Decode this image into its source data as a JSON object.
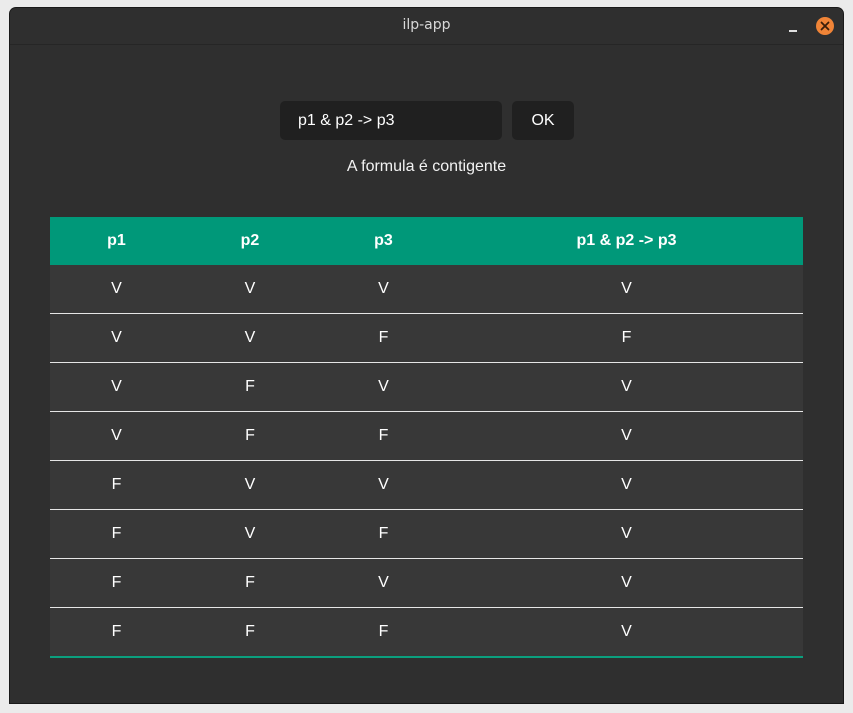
{
  "window": {
    "title": "ilp-app"
  },
  "form": {
    "formula_value": "p1 & p2 -> p3",
    "ok_label": "OK"
  },
  "result": {
    "text": "A formula é contigente"
  },
  "table": {
    "headers": [
      "p1",
      "p2",
      "p3",
      "p1 & p2 -> p3"
    ],
    "rows": [
      [
        "V",
        "V",
        "V",
        "V"
      ],
      [
        "V",
        "V",
        "F",
        "F"
      ],
      [
        "V",
        "F",
        "V",
        "V"
      ],
      [
        "V",
        "F",
        "F",
        "V"
      ],
      [
        "F",
        "V",
        "V",
        "V"
      ],
      [
        "F",
        "V",
        "F",
        "V"
      ],
      [
        "F",
        "F",
        "V",
        "V"
      ],
      [
        "F",
        "F",
        "F",
        "V"
      ]
    ]
  },
  "colors": {
    "background": "#2f2f2f",
    "header": "#009879",
    "row": "#383838",
    "input": "#202020",
    "close_button": "#f08437"
  },
  "icons": {
    "minimize": "minimize-icon",
    "close": "close-icon"
  }
}
